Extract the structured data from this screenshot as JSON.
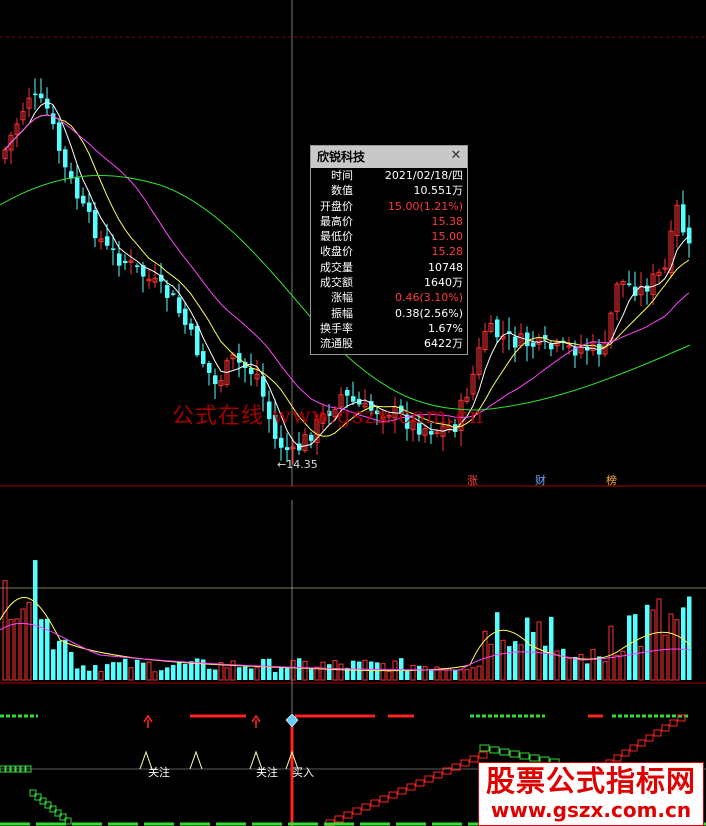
{
  "stock": {
    "name": "欣锐科技",
    "rows": [
      {
        "k": "时间",
        "v": "2021/02/18/四",
        "color": "white"
      },
      {
        "k": "数值",
        "v": "10.551万",
        "color": "white"
      },
      {
        "k": "开盘价",
        "v": "15.00(1.21%)",
        "color": "red"
      },
      {
        "k": "最高价",
        "v": "15.38",
        "color": "red"
      },
      {
        "k": "最低价",
        "v": "15.00",
        "color": "red"
      },
      {
        "k": "收盘价",
        "v": "15.28",
        "color": "red"
      },
      {
        "k": "成交量",
        "v": "10748",
        "color": "white"
      },
      {
        "k": "成交额",
        "v": "1640万",
        "color": "white"
      },
      {
        "k": "涨幅",
        "v": "0.46(3.10%)",
        "color": "red"
      },
      {
        "k": "振幅",
        "v": "0.38(2.56%)",
        "color": "white"
      },
      {
        "k": "换手率",
        "v": "1.67%",
        "color": "white"
      },
      {
        "k": "流通股",
        "v": "6422万",
        "color": "white"
      }
    ]
  },
  "chart": {
    "low_label": "14.35",
    "watermark": "公式在线 www.gszx.com.cn",
    "tags": [
      "涨",
      "财",
      "榜"
    ],
    "signals": {
      "watch1": "关注",
      "watch2": "关注",
      "buy": "买入"
    }
  },
  "badge": {
    "line1": "股票公式指标网",
    "line2": "www.gszx.com.cn"
  },
  "colors": {
    "up": "#ff3232",
    "down": "#54ffff",
    "ma5": "#ffffff",
    "ma10": "#ffff55",
    "ma20": "#ff44ff",
    "ma60": "#33dd33",
    "signal_red": "#ff2222",
    "signal_green": "#33dd33"
  }
}
